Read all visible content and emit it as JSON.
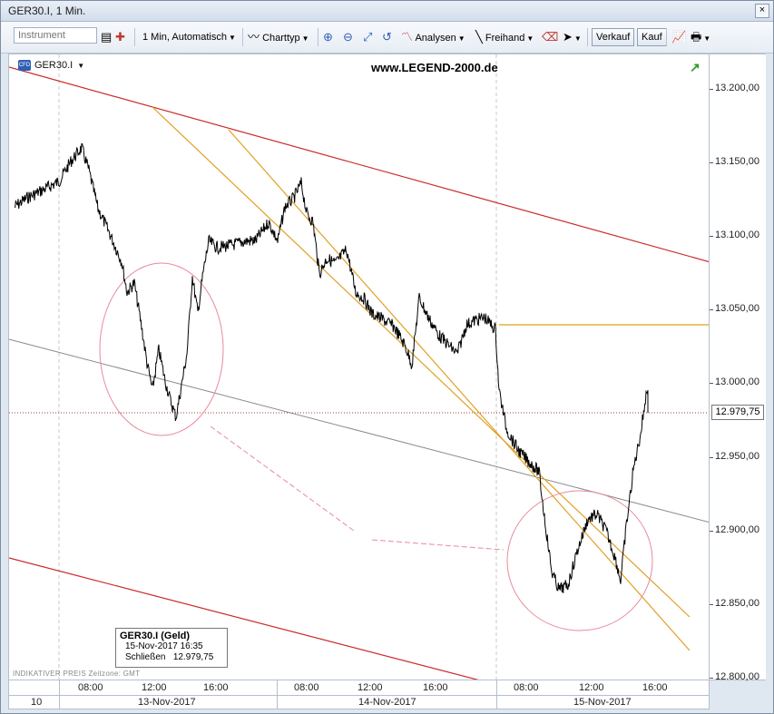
{
  "window": {
    "title": "GER30.I, 1 Min.",
    "close_label": "×"
  },
  "toolbar": {
    "instrument_placeholder": "Instrument",
    "interval_label": "1 Min,",
    "scale_label": "Automatisch",
    "charttype_label": "Charttyp",
    "analysen_label": "Analysen",
    "freihand_label": "Freihand",
    "verkauf_label": "Verkauf",
    "kauf_label": "Kauf"
  },
  "chart": {
    "symbol": "GER30.I",
    "cfd_badge": "CFD",
    "watermark": "www.LEGEND-2000.de",
    "current_price": "12.979,75",
    "info": {
      "title": "GER30.I (Geld)",
      "date": "15-Nov-2017 16:35",
      "close_label": "Schließen",
      "close_value": "12.979,75"
    },
    "footer_note": "INDIKATIVER PREIS   Zeitzone: GMT"
  },
  "yaxis": {
    "ticks": [
      "13.200,00",
      "13.150,00",
      "13.100,00",
      "13.050,00",
      "13.000,00",
      "12.950,00",
      "12.900,00",
      "12.850,00",
      "12.800,00"
    ]
  },
  "xaxis": {
    "corner_label": "10",
    "times": [
      "08:00",
      "12:00",
      "16:00",
      "08:00",
      "12:00",
      "16:00",
      "08:00",
      "12:00",
      "16:00"
    ],
    "days": [
      "13-Nov-2017",
      "14-Nov-2017",
      "15-Nov-2017"
    ]
  },
  "colors": {
    "price_line": "#000000",
    "channel_red": "#cc2a2a",
    "channel_orange": "#e0a020",
    "midline_gray": "#8a8a8a",
    "circle_pink": "#e88a9a"
  }
}
